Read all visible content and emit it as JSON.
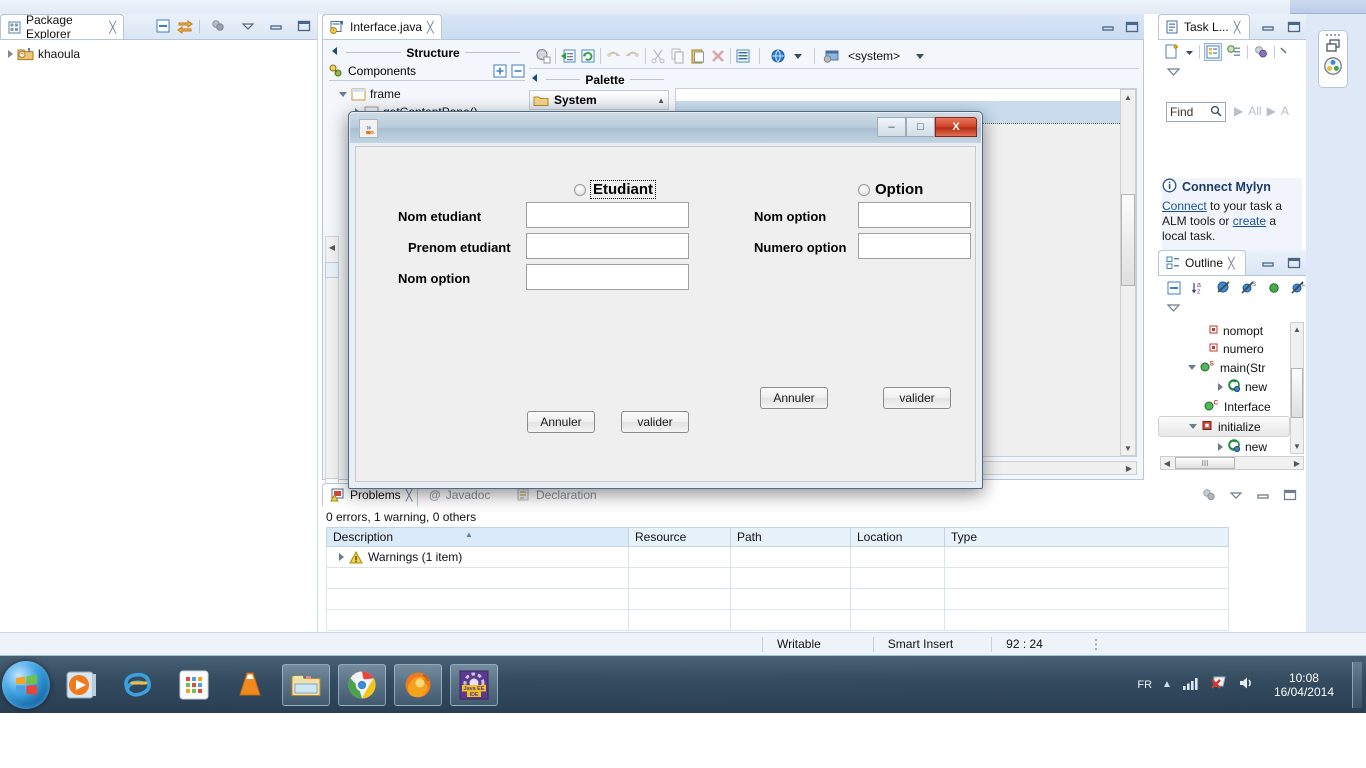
{
  "desktop": {
    "wallpaper_note": ""
  },
  "eclipse": {
    "package_explorer": {
      "tab_label": "Package Explorer",
      "close_glyph": "╳",
      "toolbar_icons": [
        "collapse-all-icon",
        "link-with-editor-icon",
        "view-menu-icon",
        "minimize-icon",
        "maximize-icon"
      ],
      "tree": [
        {
          "label": "khaoula",
          "icon": "java-project-icon",
          "expander": "collapsed"
        }
      ]
    },
    "editor": {
      "tab_label": "Interface.java",
      "close_glyph": "╳",
      "structure_title": "Structure",
      "components_title": "Components",
      "palette_title": "Palette",
      "palette_group": "System",
      "tree": [
        {
          "label": "frame",
          "depth": 0
        },
        {
          "label": "getContentPane()",
          "depth": 1
        }
      ],
      "toolbar": {
        "combo_value": "<system>",
        "icons": [
          "test-icon",
          "open-source-icon",
          "refresh-icon",
          "undo-icon",
          "redo-icon",
          "cut-icon",
          "copy-icon",
          "paste-icon",
          "delete-icon",
          "properties-icon",
          "globe-icon",
          "laf-icon"
        ]
      },
      "design_surface": {
        "partial_label": "diant",
        "button_label": "valider"
      }
    },
    "problems": {
      "tabs": [
        {
          "label": "Problems",
          "active": true,
          "icon": "problems-icon"
        },
        {
          "label": "Javadoc",
          "active": false,
          "icon": "javadoc-icon"
        },
        {
          "label": "Declaration",
          "active": false,
          "icon": "declaration-icon"
        }
      ],
      "close_glyph": "╳",
      "summary": "0 errors, 1 warning, 0 others",
      "columns": [
        "Description",
        "Resource",
        "Path",
        "Location",
        "Type"
      ],
      "rows": [
        {
          "description": "Warnings (1 item)",
          "resource": "",
          "path": "",
          "location": "",
          "type": "",
          "icon": "warning-icon",
          "expander": "collapsed"
        },
        {
          "description": "",
          "resource": "",
          "path": "",
          "location": "",
          "type": ""
        },
        {
          "description": "",
          "resource": "",
          "path": "",
          "location": "",
          "type": ""
        },
        {
          "description": "",
          "resource": "",
          "path": "",
          "location": "",
          "type": ""
        }
      ],
      "toolbar_icons": [
        "focus-icon",
        "view-menu-icon",
        "minimize-icon",
        "maximize-icon"
      ]
    },
    "task_list": {
      "tab_label": "Task L...",
      "close_glyph": "╳",
      "find_placeholder": "Find",
      "find_value": "",
      "filters": [
        "All",
        "A"
      ],
      "toolbar_icons": [
        "new-task-icon",
        "dropdown-icon",
        "categorized-icon",
        "scheduled-icon",
        "focus-icon",
        "more-icon",
        "view-menu-icon"
      ],
      "mylyn": {
        "title": "Connect Mylyn",
        "line1_link": "Connect",
        "line1_rest": " to your task a",
        "line2_pre": "ALM tools or ",
        "line2_link": "create",
        "line2_post": " a",
        "line3": "local task.",
        "icon": "info-icon"
      }
    },
    "outline": {
      "tab_label": "Outline",
      "close_glyph": "╳",
      "toolbar_icons": [
        "collapse-all-icon",
        "sort-icon",
        "hide-fields-icon",
        "hide-static-icon",
        "hide-nonpublic-icon",
        "hide-local-icon",
        "view-menu-icon"
      ],
      "tree": [
        {
          "label": "nomopt",
          "icon": "field-private-icon",
          "depth": 1
        },
        {
          "label": "numero",
          "icon": "field-private-icon",
          "depth": 1
        },
        {
          "label": "main(Str",
          "icon": "method-public-static-icon",
          "depth": 0,
          "expander": "expanded",
          "badge": "S"
        },
        {
          "label": "new",
          "icon": "anonymous-class-icon",
          "depth": 2,
          "expander": "collapsed"
        },
        {
          "label": "Interface",
          "icon": "constructor-icon",
          "depth": 1,
          "badge": "C"
        },
        {
          "label": "initialize",
          "icon": "method-private-icon",
          "depth": 0,
          "expander": "expanded",
          "selected": true
        },
        {
          "label": "new",
          "icon": "anonymous-class-icon",
          "depth": 2,
          "expander": "collapsed"
        }
      ]
    },
    "status_bar": {
      "writable": "Writable",
      "insert_mode": "Smart Insert",
      "cursor_position": "92 : 24"
    }
  },
  "dialog": {
    "title": "",
    "app_icon": "java-coffee-icon",
    "window_buttons": {
      "minimize": "–",
      "maximize": "□",
      "close": "X"
    },
    "radios": [
      {
        "label": "Etudiant",
        "selected": false,
        "focused": true
      },
      {
        "label": "Option",
        "selected": false,
        "focused": false
      }
    ],
    "left_form": {
      "fields": [
        {
          "label": "Nom etudiant",
          "value": ""
        },
        {
          "label": "Prenom etudiant",
          "value": ""
        },
        {
          "label": "Nom option",
          "value": ""
        }
      ],
      "buttons": [
        {
          "label": "Annuler"
        },
        {
          "label": "valider"
        }
      ]
    },
    "right_form": {
      "fields": [
        {
          "label": "Nom  option",
          "value": ""
        },
        {
          "label": "Numero option",
          "value": ""
        }
      ],
      "buttons": [
        {
          "label": "Annuler"
        },
        {
          "label": "valider"
        }
      ]
    }
  },
  "taskbar": {
    "start_label": "start-orb",
    "items": [
      {
        "name": "windows-media-player-icon",
        "pinned": false
      },
      {
        "name": "internet-explorer-icon",
        "pinned": false
      },
      {
        "name": "microsoft-store-icon",
        "pinned": false
      },
      {
        "name": "vlc-icon",
        "pinned": false
      },
      {
        "name": "file-explorer-icon",
        "pinned": true
      },
      {
        "name": "google-chrome-icon",
        "pinned": true
      },
      {
        "name": "mozilla-firefox-icon",
        "pinned": true
      },
      {
        "name": "eclipse-javaee-icon",
        "pinned": true,
        "label": "Java EE IDE"
      }
    ],
    "tray": {
      "language": "FR",
      "icons": [
        "show-hidden-icons-icon",
        "network-icon",
        "action-center-icon",
        "volume-icon"
      ]
    },
    "clock": {
      "time": "10:08",
      "date": "16/04/2014"
    }
  },
  "colors": {
    "eclipse_bg": "#f6f8fb",
    "tab_blue": "#dfe8f6",
    "dialog_face": "#efefef",
    "close_red": "#c0392b",
    "link_blue": "#16539e",
    "taskbar": "#2d485c"
  }
}
